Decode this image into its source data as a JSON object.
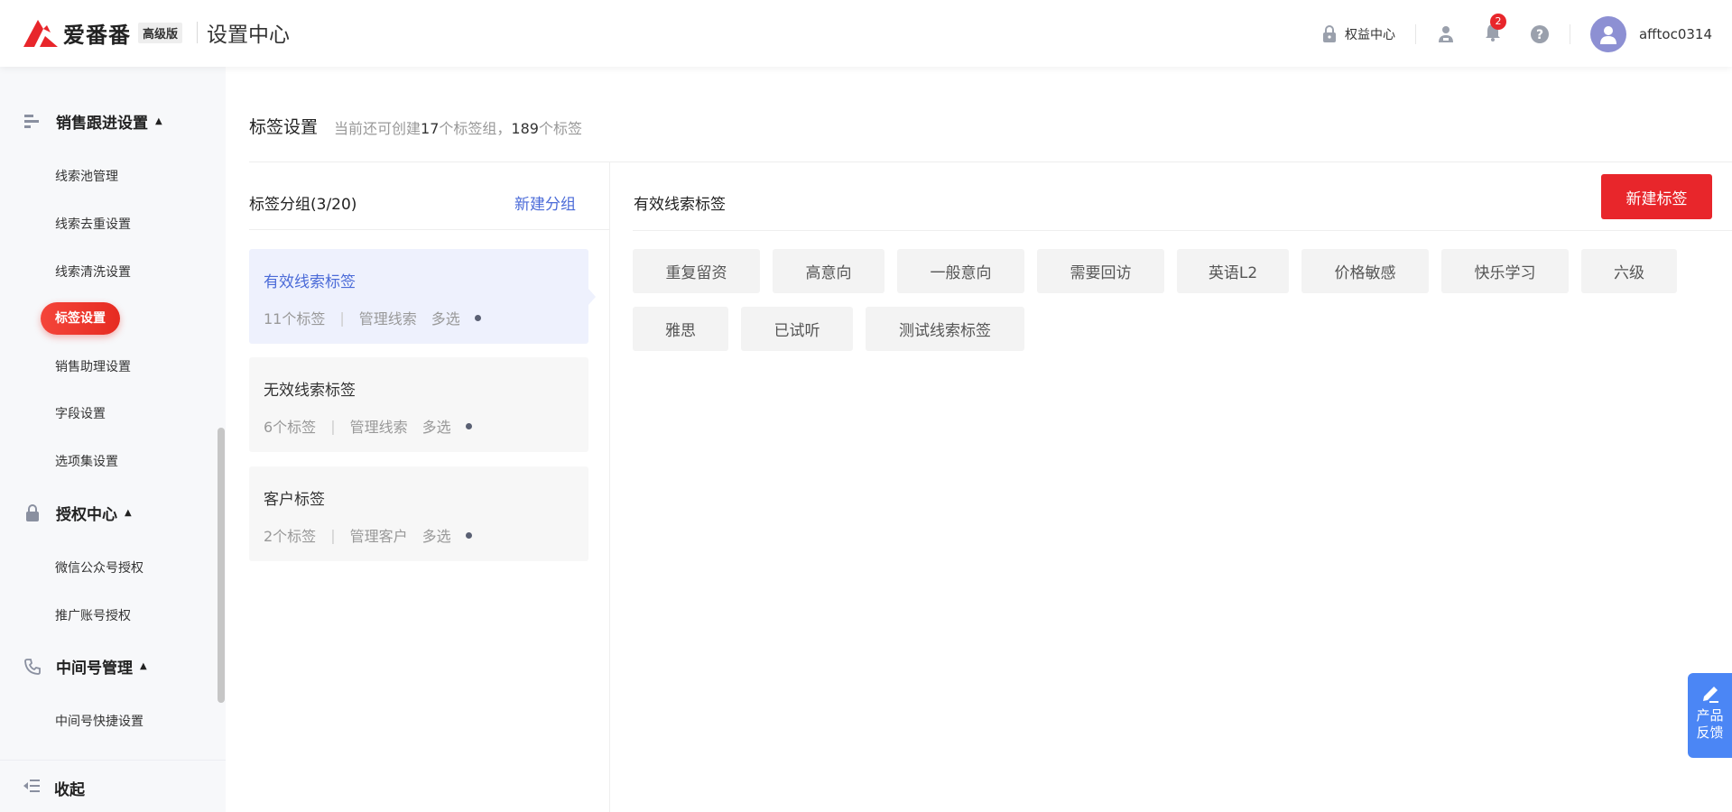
{
  "header": {
    "brand": "爱番番",
    "edition_badge": "高级版",
    "section_title": "设置中心",
    "benefits_label": "权益中心",
    "notification_count": "2",
    "username": "afftoc0314"
  },
  "sidebar": {
    "groups": [
      {
        "label": "销售跟进设置",
        "icon": "list-icon"
      },
      {
        "label": "授权中心",
        "icon": "lock-icon"
      },
      {
        "label": "中间号管理",
        "icon": "phone-icon"
      }
    ],
    "items": [
      "线索池管理",
      "线索去重设置",
      "线索清洗设置",
      "标签设置",
      "销售助理设置",
      "字段设置",
      "选项集设置",
      "微信公众号授权",
      "推广账号授权",
      "中间号快捷设置"
    ],
    "collapse_label": "收起"
  },
  "page": {
    "title": "标签设置",
    "subtitle_prefix": "当前还可创建",
    "subtitle_groups_left": "17",
    "subtitle_middle": "个标签组，",
    "subtitle_tags_left": "189",
    "subtitle_suffix": "个标签"
  },
  "groups_panel": {
    "title": "标签分组(3/20)",
    "new_group_label": "新建分组",
    "groups": [
      {
        "name": "有效线索标签",
        "count": "11个标签",
        "role": "管理线索",
        "mode": "多选"
      },
      {
        "name": "无效线索标签",
        "count": "6个标签",
        "role": "管理线索",
        "mode": "多选"
      },
      {
        "name": "客户标签",
        "count": "2个标签",
        "role": "管理客户",
        "mode": "多选"
      }
    ]
  },
  "tags_panel": {
    "title": "有效线索标签",
    "new_tag_label": "新建标签",
    "tags": [
      "重复留资",
      "高意向",
      "一般意向",
      "需要回访",
      "英语L2",
      "价格敏感",
      "快乐学习",
      "六级",
      "雅思",
      "已试听",
      "测试线索标签"
    ]
  },
  "feedback": {
    "line1": "产品",
    "line2": "反馈"
  },
  "colors": {
    "brand_red": "#e8262b",
    "link_blue": "#4b6bd8",
    "feedback_blue": "#4b86f5"
  }
}
